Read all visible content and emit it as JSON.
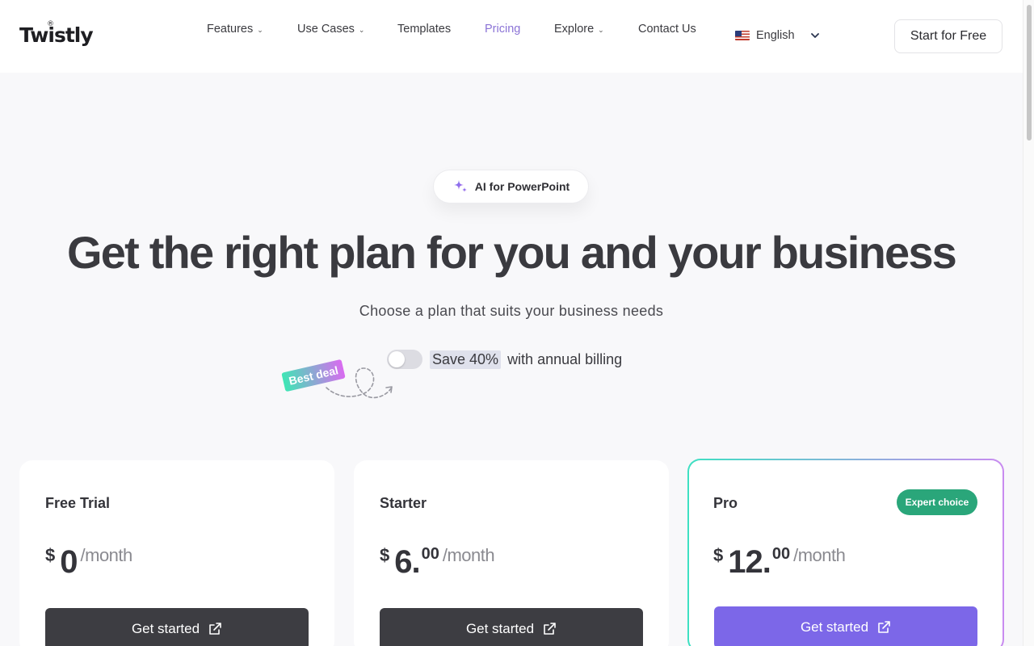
{
  "brand": {
    "name": "Twistly",
    "reg": "®"
  },
  "nav": {
    "items": [
      {
        "label": "Features",
        "has_dropdown": true
      },
      {
        "label": "Use Cases",
        "has_dropdown": true
      },
      {
        "label": "Templates",
        "has_dropdown": false
      },
      {
        "label": "Pricing",
        "has_dropdown": false,
        "active": true
      },
      {
        "label": "Explore",
        "has_dropdown": true
      },
      {
        "label": "Contact Us",
        "has_dropdown": false
      }
    ],
    "language": {
      "label": "English",
      "flag": "us-flag-icon"
    },
    "cta": "Start for Free"
  },
  "hero": {
    "pill": "AI for PowerPoint",
    "title": "Get the right plan for you and your business",
    "subtitle": "Choose a plan that suits your business needs",
    "billing": {
      "highlight": "Save 40%",
      "text": "with annual billing",
      "annual_enabled": false
    },
    "best_deal": "Best deal"
  },
  "plans": [
    {
      "name": "Free Trial",
      "currency": "$",
      "amount": "0",
      "cents": "",
      "period": "/month",
      "cta": "Get started"
    },
    {
      "name": "Starter",
      "currency": "$",
      "amount": "6.",
      "cents": "00",
      "period": "/month",
      "cta": "Get started"
    },
    {
      "name": "Pro",
      "currency": "$",
      "amount": "12.",
      "cents": "00",
      "period": "/month",
      "cta": "Get started",
      "badge": "Expert choice"
    }
  ],
  "colors": {
    "accent": "#7c67e8",
    "active_nav": "#8b73d6",
    "badge": "#2aa67a",
    "dark_button": "#3d3d42"
  }
}
